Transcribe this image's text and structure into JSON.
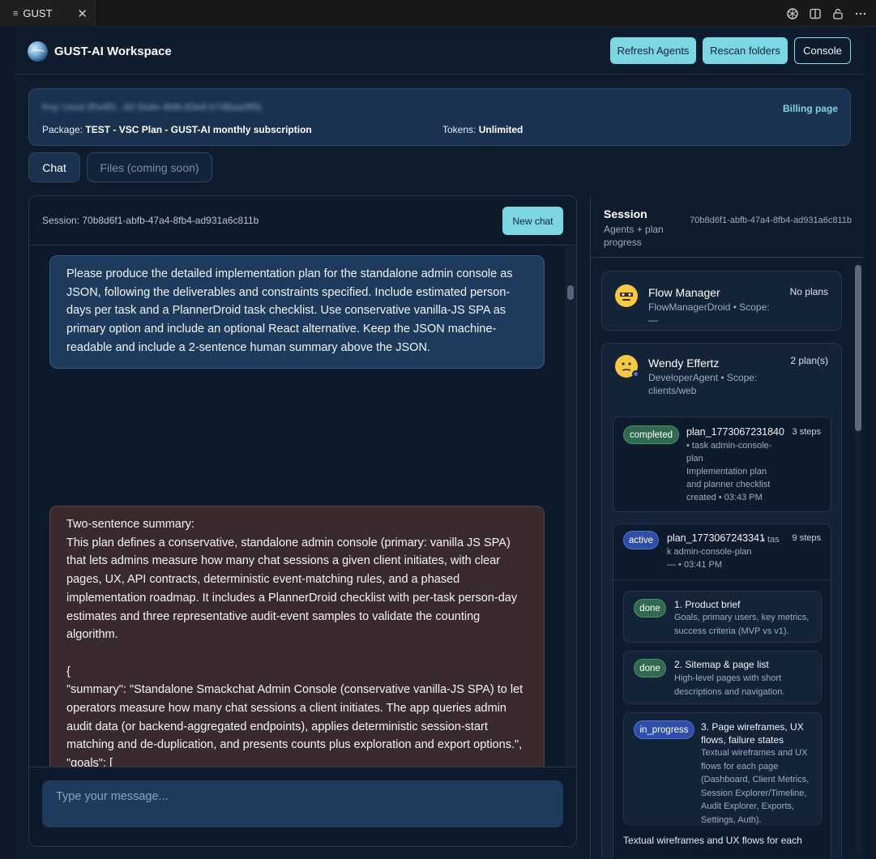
{
  "tab": {
    "icon": "list-icon",
    "label": "GUST",
    "close": "✕"
  },
  "header": {
    "title": "GUST-AI Workspace",
    "refresh_label": "Refresh Agents",
    "rescan_label": "Rescan folders",
    "console_label": "Console"
  },
  "account": {
    "id_label": "Key Used (Rs4f3...b0-9a4e-4bfb-83e8-b7d8aa0ff9)",
    "package_label": "Package:",
    "package_value": "TEST - VSC Plan - GUST-AI monthly subscription",
    "tokens_label": "Tokens:",
    "tokens_value": "Unlimited",
    "billing_label": "Billing page"
  },
  "tabs": {
    "chat": "Chat",
    "files": "Files (coming soon)"
  },
  "chat": {
    "session_label": "Session: 70b8d6f1-abfb-47a4-8fb4-ad931a6c811b",
    "new_chat_label": "New chat",
    "user_message": "Please produce the detailed implementation plan for the standalone admin console as JSON, following the deliverables and constraints specified. Include estimated person-days per task and a PlannerDroid task checklist. Use conservative vanilla-JS SPA as primary option and include an optional React alternative. Keep the JSON machine-readable and include a 2-sentence human summary above the JSON.",
    "agent_message": "Two-sentence summary:\nThis plan defines a conservative, standalone admin console (primary: vanilla JS SPA) that lets admins measure how many chat sessions a given client initiates, with clear pages, UX, API contracts, deterministic event-matching rules, and a phased implementation roadmap. It includes a PlannerDroid checklist with per-task person-day estimates and three representative audit-event samples to validate the counting algorithm.\n\n{\n\"summary\": \"Standalone Smackchat Admin Console (conservative vanilla-JS SPA) to let operators measure how many chat sessions a client initiates. The app queries admin audit data (or backend-aggregated endpoints), applies deterministic session-start matching and de-duplication, and presents counts plus exploration and export options.\",\n\"goals\": [\n\"Allow admins to enter a client id and date range and get an accurate count of chat",
    "input_placeholder": "Type your message..."
  },
  "session": {
    "title": "Session",
    "subtitle": "Agents + plan progress",
    "id": "70b8d6f1-abfb-47a4-8fb4-ad931a6c811b",
    "agents": [
      {
        "name": "Flow Manager",
        "meta": "FlowManagerDroid • Scope: —",
        "plans": "No plans",
        "avatar": "robot-face-icon"
      },
      {
        "name": "Wendy Effertz",
        "meta": "DeveloperAgent • Scope: clients/web",
        "plans": "2 plan(s)",
        "avatar": "thinking-face-icon"
      }
    ],
    "plans": [
      {
        "status": "completed",
        "name": "plan_1773067231840",
        "steps": "3 steps",
        "meta": "• task admin-console-plan\nImplementation plan and planner checklist\ncreated • 03:43 PM"
      },
      {
        "status": "active",
        "name": "plan_1773067243341",
        "meta_inline": " • tas",
        "steps": "9 steps",
        "meta": "k admin-console-plan\n— • 03:41 PM"
      }
    ],
    "steps": [
      {
        "status": "done",
        "title": "1. Product brief",
        "desc": "Goals, primary users, key metrics, success criteria (MVP vs v1)."
      },
      {
        "status": "done",
        "title": "2. Sitemap & page list",
        "desc": "High-level pages with short descriptions and navigation."
      },
      {
        "status": "in_progress",
        "title": "3. Page wireframes, UX flows, failure states",
        "desc": "Textual wireframes and UX flows for each page (Dashboard, Client Metrics, Session Explorer/Timeline, Audit Explorer, Exports, Settings, Auth)."
      }
    ],
    "trailing_text": "Textual wireframes and UX flows for each"
  }
}
